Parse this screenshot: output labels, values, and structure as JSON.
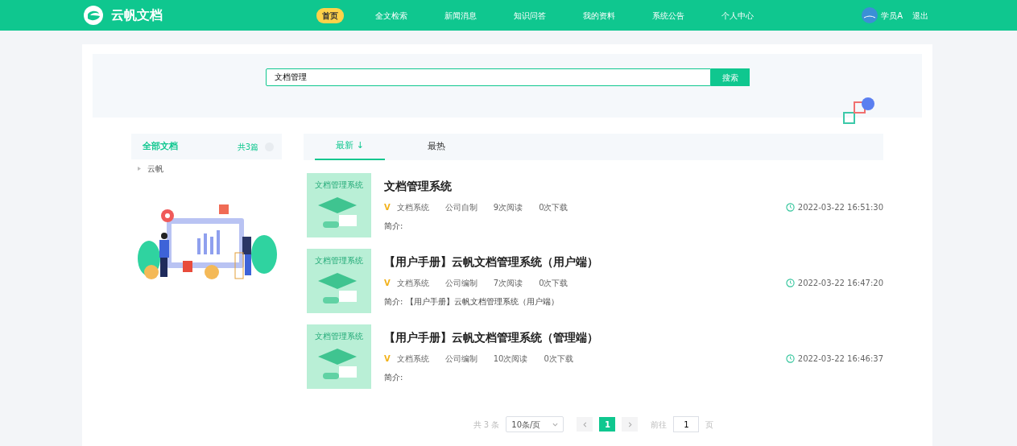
{
  "brand": "云帆文档",
  "nav": [
    {
      "label": "首页",
      "selected": true
    },
    {
      "label": "全文检索",
      "selected": false
    },
    {
      "label": "新闻消息",
      "selected": false
    },
    {
      "label": "知识问答",
      "selected": false
    },
    {
      "label": "我的资料",
      "selected": false
    },
    {
      "label": "系统公告",
      "selected": false
    },
    {
      "label": "个人中心",
      "selected": false
    }
  ],
  "user": {
    "name": "学员A",
    "logout": "退出"
  },
  "search": {
    "value": "文档管理",
    "button": "搜索"
  },
  "sidebar": {
    "title": "全部文档",
    "count": "共3篇",
    "items": [
      {
        "label": "云帆"
      }
    ]
  },
  "tabs": [
    {
      "label": "最新",
      "sort_arrow": "↓",
      "selected": true
    },
    {
      "label": "最热",
      "selected": false
    }
  ],
  "documents": [
    {
      "cover_text": "文档管理系统",
      "title": "文档管理系统",
      "tag": "V",
      "category": "文档系统",
      "source": "公司自制",
      "reads": "9次阅读",
      "downloads": "0次下载",
      "time": "2022-03-22 16:51:30",
      "summary_label": "简介:"
    },
    {
      "cover_text": "文档管理系统",
      "title": "【用户手册】云帆文档管理系统（用户端）",
      "tag": "V",
      "category": "文档系统",
      "source": "公司编制",
      "reads": "7次阅读",
      "downloads": "0次下载",
      "time": "2022-03-22 16:47:20",
      "summary_label": "简介:",
      "summary": "【用户手册】云帆文档管理系统（用户端）"
    },
    {
      "cover_text": "文档管理系统",
      "title": "【用户手册】云帆文档管理系统（管理端）",
      "tag": "V",
      "category": "文档系统",
      "source": "公司编制",
      "reads": "10次阅读",
      "downloads": "0次下载",
      "time": "2022-03-22 16:46:37",
      "summary_label": "简介:"
    }
  ],
  "pagination": {
    "total": "共 3 条",
    "page_size": "10条/页",
    "pages": [
      {
        "label": "1",
        "selected": true
      }
    ],
    "goto_label": "前往",
    "goto_value": "1",
    "goto_suffix": "页"
  }
}
